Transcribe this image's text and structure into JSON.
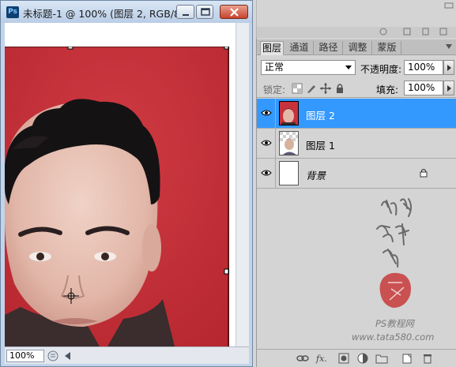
{
  "document_window": {
    "app_icon": "Ps",
    "title": "未标题-1 @ 100% (图层 2, RGB/8...",
    "controls": [
      "minimize-icon",
      "maximize-icon",
      "close-icon"
    ],
    "zoom_level": "100%"
  },
  "layers_panel": {
    "tabs": [
      {
        "label": "图层",
        "active": true
      },
      {
        "label": "通道",
        "active": false
      },
      {
        "label": "路径",
        "active": false
      },
      {
        "label": "调整",
        "active": false
      },
      {
        "label": "蒙版",
        "active": false
      }
    ],
    "blend_mode": "正常",
    "opacity_label": "不透明度:",
    "opacity_value": "100%",
    "lock_label": "锁定:",
    "fill_label": "填充:",
    "fill_value": "100%",
    "layers": [
      {
        "name": "图层 2",
        "selected": true,
        "visible": true,
        "thumb": "portrait-red"
      },
      {
        "name": "图层 1",
        "selected": false,
        "visible": true,
        "thumb": "portrait-transparent"
      },
      {
        "name": "背景",
        "selected": false,
        "visible": true,
        "thumb": "white",
        "locked": true
      }
    ],
    "bottom_icons": [
      "link-icon",
      "fx-icon",
      "mask-icon",
      "adjustment-icon",
      "folder-icon",
      "new-layer-icon",
      "trash-icon"
    ]
  },
  "watermark": {
    "calligraphy": "他她我帮你",
    "caption": "PS教程网",
    "url": "www.tata580.com"
  },
  "colors": {
    "selection_blue": "#3399ff",
    "photo_background_red": "#c8323c",
    "title_bar": "#c2d4ea"
  }
}
